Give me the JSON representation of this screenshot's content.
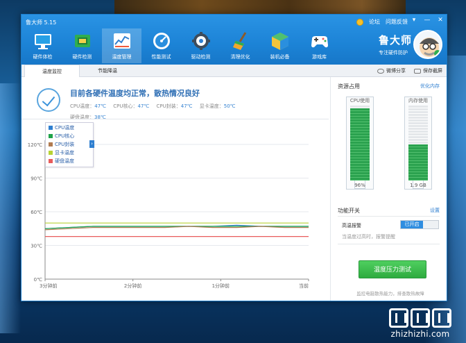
{
  "window": {
    "title": "鲁大师 5.15"
  },
  "sys_links": {
    "forum": "论坛",
    "feedback": "问题反馈"
  },
  "window_controls": {
    "menu": "▾",
    "minimize": "—",
    "close": "✕"
  },
  "toolbar": [
    {
      "label": "硬件体检",
      "icon": "monitor-icon"
    },
    {
      "label": "硬件检测",
      "icon": "chip-icon"
    },
    {
      "label": "温度管理",
      "icon": "temperature-chart-icon",
      "active": true
    },
    {
      "label": "性能测试",
      "icon": "gauge-icon"
    },
    {
      "label": "驱动检测",
      "icon": "gear-icon"
    },
    {
      "label": "清理优化",
      "icon": "broom-icon"
    },
    {
      "label": "装机必备",
      "icon": "box-icon"
    },
    {
      "label": "游戏库",
      "icon": "gamepad-icon"
    }
  ],
  "brand": {
    "name": "鲁大师",
    "slogan": "专注硬件防护"
  },
  "subtabs": {
    "temp_monitor": "温度监控",
    "energy_saving": "节能降温"
  },
  "subtab_actions": {
    "weibo_share": "微博分享",
    "save_screenshot": "保存截屏"
  },
  "status": {
    "title": "目前各硬件温度均正常，散热情况良好",
    "items": [
      {
        "label": "CPU温度：",
        "value": "47℃"
      },
      {
        "label": "CPU核心：",
        "value": "47℃"
      },
      {
        "label": "CPU封装：",
        "value": "47℃"
      },
      {
        "label": "显卡温度：",
        "value": "50℃"
      },
      {
        "label": "硬盘温度：",
        "value": "38℃"
      }
    ]
  },
  "legend": [
    {
      "label": "CPU温度",
      "color": "#2f7fd0"
    },
    {
      "label": "CPU核心",
      "color": "#1fa34a"
    },
    {
      "label": "CPU封装",
      "color": "#b07b50"
    },
    {
      "label": "显卡温度",
      "color": "#b7d334"
    },
    {
      "label": "硬盘温度",
      "color": "#e85b5b"
    }
  ],
  "chart_data": {
    "type": "line",
    "y_ticks": [
      "120℃",
      "90℃",
      "60℃",
      "30℃",
      "0℃"
    ],
    "ylim": [
      0,
      120
    ],
    "x_ticks": [
      "3分钟前",
      "2分钟前",
      "1分钟前",
      "当前"
    ],
    "series": [
      {
        "name": "CPU温度",
        "color": "#2f7fd0",
        "values": [
          45,
          46,
          47,
          47,
          47,
          47,
          47,
          47,
          48,
          47,
          47,
          47
        ]
      },
      {
        "name": "CPU核心",
        "color": "#1fa34a",
        "values": [
          45,
          46,
          47,
          47,
          47,
          47,
          47,
          47,
          47,
          47,
          47,
          47
        ]
      },
      {
        "name": "CPU封装",
        "color": "#b07b50",
        "values": [
          44,
          45,
          46,
          46,
          46,
          46,
          47,
          46,
          46,
          47,
          46,
          46
        ]
      },
      {
        "name": "显卡温度",
        "color": "#b7d334",
        "values": [
          50,
          50,
          50,
          50,
          50,
          50,
          50,
          50,
          50,
          50,
          50,
          50
        ]
      },
      {
        "name": "硬盘温度",
        "color": "#e85b5b",
        "values": [
          38,
          38,
          38,
          38,
          38,
          38,
          38,
          38,
          38,
          38,
          38,
          38
        ]
      }
    ]
  },
  "resources": {
    "title": "资源占用",
    "optimize": "优化内存",
    "cpu": {
      "label": "CPU使用",
      "value_text": "96%",
      "fraction": 0.96
    },
    "memory": {
      "label": "内存使用",
      "value_text": "1.9 GB",
      "fraction": 0.48
    }
  },
  "switches": {
    "title": "功能开关",
    "settings": "设置",
    "alarm_label": "高温报警",
    "alarm_state": "已开启",
    "alarm_desc": "当温度过高时，报警提醒"
  },
  "stress_test": {
    "button": "温度压力测试",
    "desc": "监控电脑散热能力，排查散热故障"
  },
  "watermark": {
    "text": "zhizhizhi.com"
  }
}
